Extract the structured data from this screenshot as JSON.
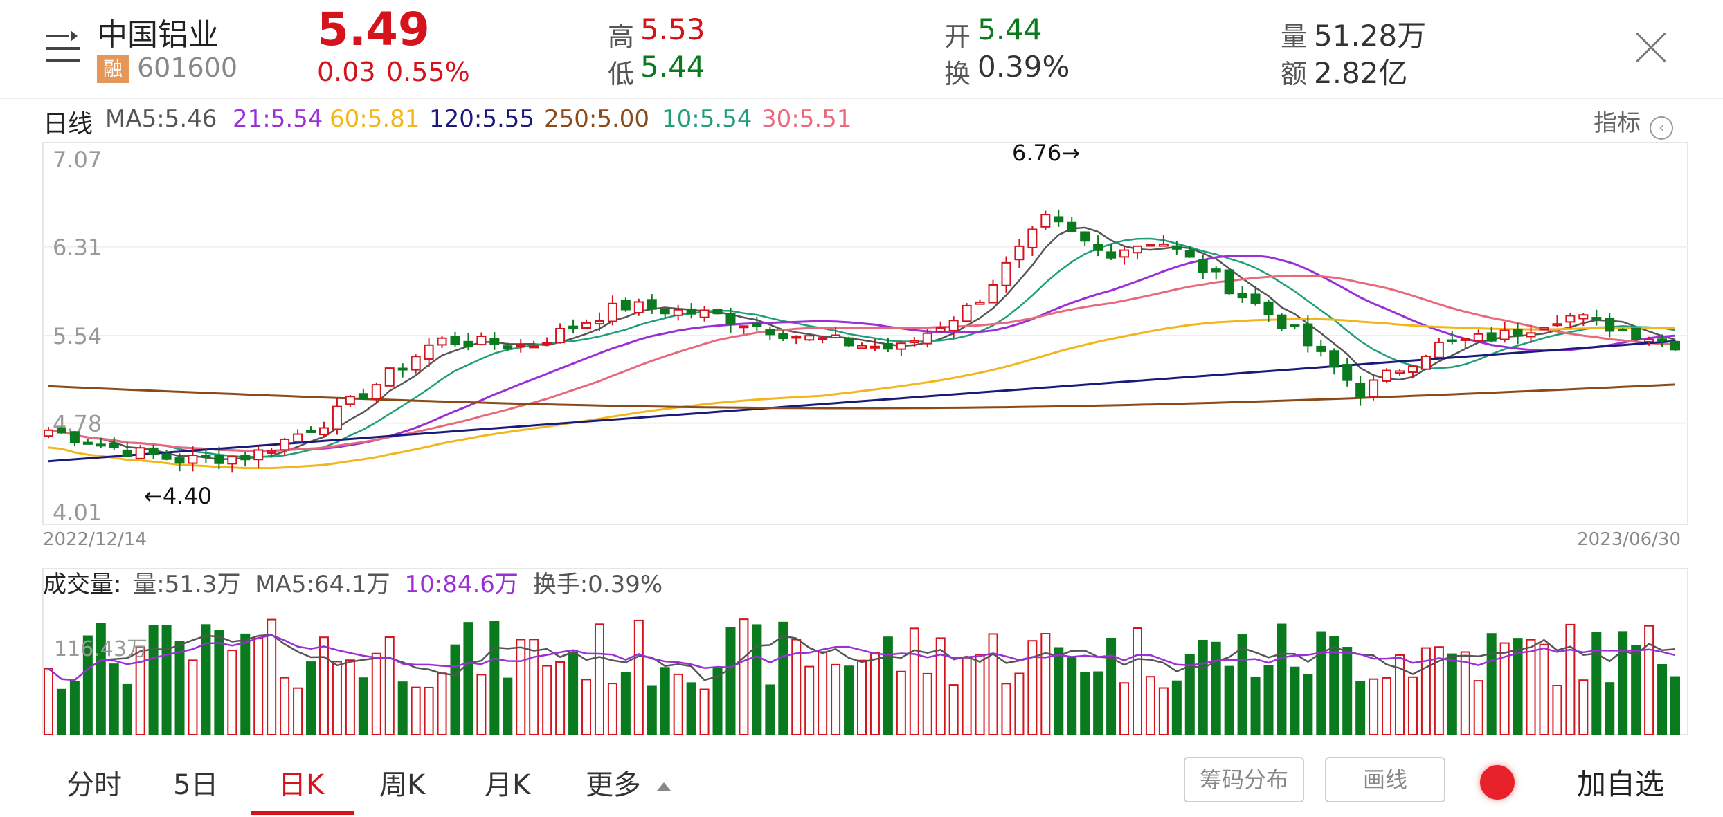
{
  "header": {
    "menu_icon": "menu-lines-icon",
    "name": "中国铝业",
    "margin_badge": "融",
    "code": "601600",
    "price": "5.49",
    "change": "0.03",
    "change_pct": "0.55%",
    "high_label": "高",
    "high_value": "5.53",
    "low_label": "低",
    "low_value": "5.44",
    "open_label": "开",
    "open_value": "5.44",
    "turnover_label": "换",
    "turnover_value": "0.39%",
    "volume_label": "量",
    "volume_value": "51.28万",
    "amount_label": "额",
    "amount_value": "2.82亿",
    "close_icon": "close-icon"
  },
  "ma_bar": {
    "period_label": "日线",
    "ma5": "MA5:5.46",
    "ma21": "21:5.54",
    "ma60": "60:5.81",
    "ma120": "120:5.55",
    "ma250": "250:5.00",
    "ma10": "10:5.54",
    "ma30": "30:5.51",
    "indicator_label": "指标"
  },
  "colors": {
    "up": "#d5131d",
    "down": "#0a7a1e",
    "ma5": "#555555",
    "ma10": "#1f9e7a",
    "ma21": "#9a2fd6",
    "ma30": "#e8697a",
    "ma60": "#f2b51a",
    "ma120": "#1a1a7a",
    "ma250": "#8a4a1a",
    "vol_ma10": "#9a2fd6"
  },
  "chart_data": {
    "type": "candlestick",
    "price_ticks": [
      "7.07",
      "6.31",
      "5.54",
      "4.78",
      "4.01"
    ],
    "ylim": [
      4.01,
      7.07
    ],
    "x_start": "2022/12/14",
    "x_end": "2023/06/30",
    "max_annotation": "6.76→",
    "min_annotation": "←4.40",
    "volume_title": "成交量:",
    "volume_line": "量:51.3万",
    "volume_ma5": "MA5:64.1万",
    "volume_ma10": "10:84.6万",
    "volume_turnover": "换手:0.39%",
    "volume_tick": "116.43万"
  },
  "tabs": {
    "items": [
      "分时",
      "5日",
      "日K",
      "周K",
      "月K",
      "更多"
    ],
    "active_index": 2,
    "chips_button": "筹码分布",
    "draw_button": "画线",
    "add_button": "加自选"
  }
}
